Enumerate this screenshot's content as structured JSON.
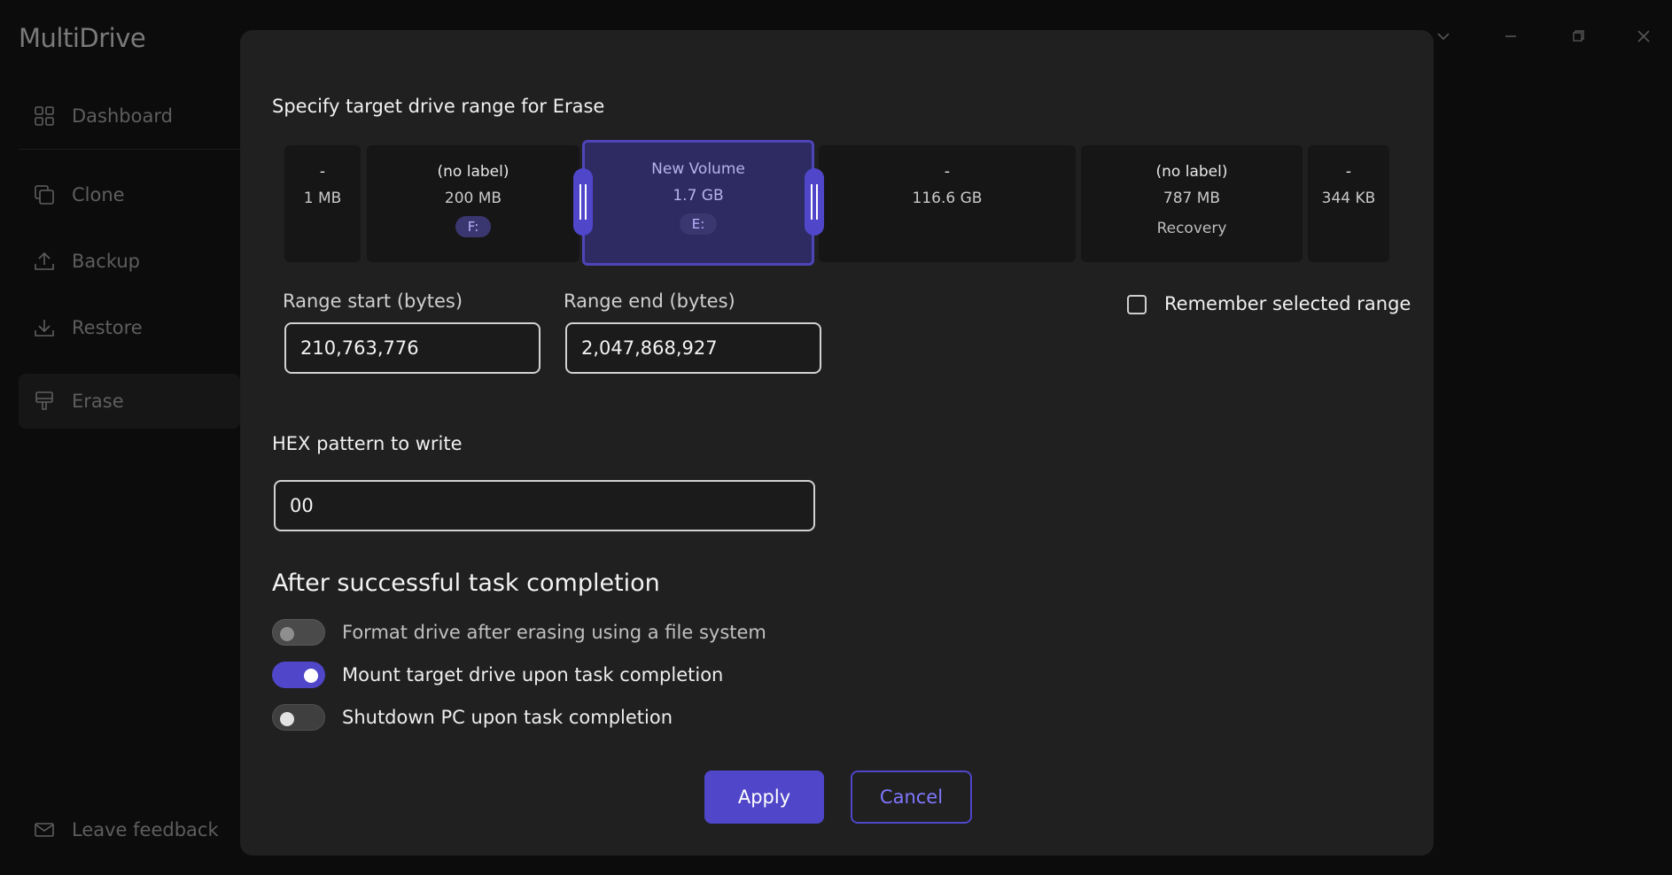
{
  "app": {
    "title": "MultiDrive"
  },
  "sidebar": {
    "items": [
      {
        "label": "Dashboard",
        "icon": "dashboard-icon"
      },
      {
        "label": "Clone",
        "icon": "clone-icon"
      },
      {
        "label": "Backup",
        "icon": "backup-icon"
      },
      {
        "label": "Restore",
        "icon": "restore-icon"
      },
      {
        "label": "Erase",
        "icon": "erase-icon",
        "active": true
      }
    ],
    "feedback": {
      "label": "Leave feedback",
      "icon": "mail-icon"
    }
  },
  "dialog": {
    "heading": "Specify target drive range for Erase",
    "partitions": [
      {
        "name": "-",
        "size": "1 MB"
      },
      {
        "name": "(no label)",
        "size": "200 MB",
        "letter": "F:"
      },
      {
        "name": "New Volume",
        "size": "1.7 GB",
        "letter": "E:",
        "selected": true
      },
      {
        "name": "-",
        "size": "116.6 GB"
      },
      {
        "name": "(no label)",
        "size": "787 MB",
        "extra": "Recovery"
      },
      {
        "name": "-",
        "size": "344 KB"
      }
    ],
    "range_start": {
      "label": "Range start (bytes)",
      "value": "210,763,776"
    },
    "range_end": {
      "label": "Range end (bytes)",
      "value": "2,047,868,927"
    },
    "remember": {
      "label": "Remember selected range",
      "checked": false
    },
    "hex": {
      "label": "HEX pattern to write",
      "value": "00"
    },
    "after": {
      "title": "After successful task completion",
      "options": [
        {
          "label": "Format drive after erasing using a file system",
          "state": "disabled"
        },
        {
          "label": "Mount target drive upon task completion",
          "state": "on"
        },
        {
          "label": "Shutdown PC upon task completion",
          "state": "off"
        }
      ]
    },
    "buttons": {
      "apply": "Apply",
      "cancel": "Cancel"
    }
  },
  "colors": {
    "accent": "#4f46c9",
    "dialog_bg": "#202020",
    "page_bg": "#0c0c0c"
  }
}
